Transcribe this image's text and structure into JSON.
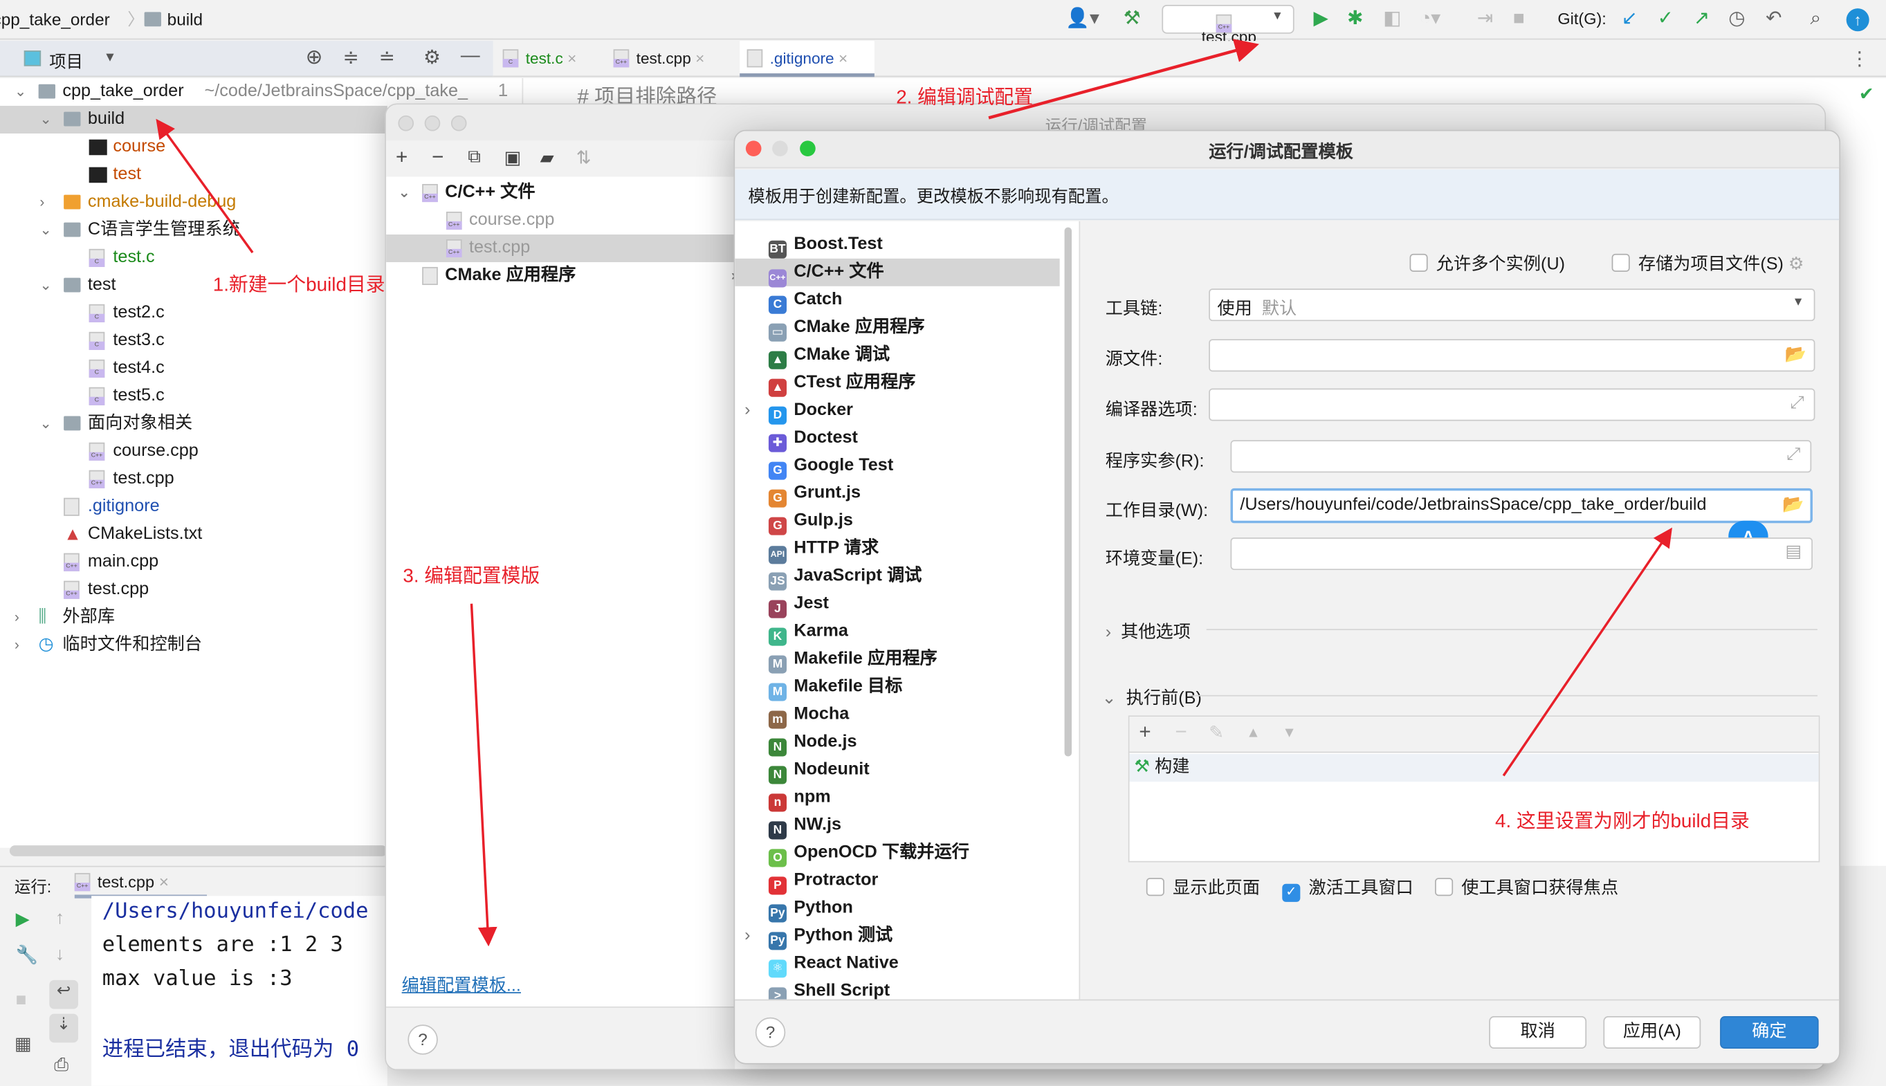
{
  "breadcrumb": {
    "project": "cpp_take_order",
    "folder": "build"
  },
  "toolbar": {
    "run_config": "test.cpp",
    "git_label": "Git(G):"
  },
  "project_panel": {
    "title": "项目"
  },
  "editor_tabs": [
    {
      "label": "test.c",
      "color": "#1a8a1a"
    },
    {
      "label": "test.cpp",
      "color": "#1a1a1a"
    },
    {
      "label": ".gitignore",
      "color": "#1f4fb0",
      "active": true
    }
  ],
  "editor": {
    "line_number": "1",
    "line_text": "# 项目排除路径"
  },
  "tree": [
    {
      "label": "cpp_take_order",
      "path": "~/code/JetbrainsSpace/cpp_take_",
      "level": 0,
      "type": "module",
      "expanded": true
    },
    {
      "label": "build",
      "level": 1,
      "type": "folder",
      "expanded": true,
      "selected": true
    },
    {
      "label": "course",
      "level": 2,
      "type": "exec",
      "color": "#c44a00"
    },
    {
      "label": "test",
      "level": 2,
      "type": "exec",
      "color": "#c44a00"
    },
    {
      "label": "cmake-build-debug",
      "level": 1,
      "type": "folder-orange",
      "collapsed": true,
      "color": "#c47a00"
    },
    {
      "label": "C语言学生管理系统",
      "level": 1,
      "type": "folder",
      "expanded": true
    },
    {
      "label": "test.c",
      "level": 2,
      "type": "c",
      "color": "#1a8a1a"
    },
    {
      "label": "test",
      "level": 1,
      "type": "folder",
      "expanded": true
    },
    {
      "label": "test2.c",
      "level": 2,
      "type": "c"
    },
    {
      "label": "test3.c",
      "level": 2,
      "type": "c"
    },
    {
      "label": "test4.c",
      "level": 2,
      "type": "c"
    },
    {
      "label": "test5.c",
      "level": 2,
      "type": "c"
    },
    {
      "label": "面向对象相关",
      "level": 1,
      "type": "folder",
      "expanded": true
    },
    {
      "label": "course.cpp",
      "level": 2,
      "type": "cpp"
    },
    {
      "label": "test.cpp",
      "level": 2,
      "type": "cpp"
    },
    {
      "label": ".gitignore",
      "level": 1,
      "type": "ignore",
      "color": "#1f4fb0"
    },
    {
      "label": "CMakeLists.txt",
      "level": 1,
      "type": "cmake"
    },
    {
      "label": "main.cpp",
      "level": 1,
      "type": "cpp"
    },
    {
      "label": "test.cpp",
      "level": 1,
      "type": "cpp"
    },
    {
      "label": "外部库",
      "level": 0,
      "type": "lib",
      "collapsed": true
    },
    {
      "label": "临时文件和控制台",
      "level": 0,
      "type": "scratch",
      "collapsed": true
    }
  ],
  "run_panel": {
    "label": "运行:",
    "tab": "test.cpp",
    "console": [
      "/Users/houyunfei/code",
      "elements are :1 2 3",
      "max value is :3",
      "",
      "进程已结束，退出代码为 0"
    ]
  },
  "run_config_dialog": {
    "title": "运行/调试配置",
    "tree": [
      {
        "label": "C/C++ 文件",
        "level": 0,
        "expanded": true
      },
      {
        "label": "course.cpp",
        "level": 1
      },
      {
        "label": "test.cpp",
        "level": 1,
        "selected": true
      },
      {
        "label": "CMake 应用程序",
        "level": 0,
        "collapsed": true
      }
    ],
    "edit_templates_link": "编辑配置模板..."
  },
  "template_dialog": {
    "title": "运行/调试配置模板",
    "info": "模板用于创建新配置。更改模板不影响现有配置。",
    "templates": [
      {
        "label": "Boost.Test",
        "icon": "BT",
        "color": "#555555"
      },
      {
        "label": "C/C++ 文件",
        "icon": "C++",
        "color": "#9b87d6",
        "selected": true
      },
      {
        "label": "Catch",
        "icon": "C",
        "color": "#3a7bd5"
      },
      {
        "label": "CMake 应用程序",
        "icon": "▭",
        "color": "#8aa0b4"
      },
      {
        "label": "CMake 调试",
        "icon": "▲",
        "color": "#2d7d46"
      },
      {
        "label": "CTest 应用程序",
        "icon": "▲",
        "color": "#d04040"
      },
      {
        "label": "Docker",
        "icon": "D",
        "color": "#2496ed",
        "expandable": true
      },
      {
        "label": "Doctest",
        "icon": "✚",
        "color": "#6b5bd8"
      },
      {
        "label": "Google Test",
        "icon": "G",
        "color": "#4285f4"
      },
      {
        "label": "Grunt.js",
        "icon": "G",
        "color": "#e48632"
      },
      {
        "label": "Gulp.js",
        "icon": "G",
        "color": "#cf4647"
      },
      {
        "label": "HTTP 请求",
        "icon": "API",
        "color": "#5c7c9c"
      },
      {
        "label": "JavaScript 调试",
        "icon": "JS",
        "color": "#8aa0b4"
      },
      {
        "label": "Jest",
        "icon": "J",
        "color": "#99425b"
      },
      {
        "label": "Karma",
        "icon": "K",
        "color": "#3fb68b"
      },
      {
        "label": "Makefile 应用程序",
        "icon": "M",
        "color": "#8aa0b4"
      },
      {
        "label": "Makefile 目标",
        "icon": "M",
        "color": "#6fb3e6"
      },
      {
        "label": "Mocha",
        "icon": "m",
        "color": "#8d6748"
      },
      {
        "label": "Node.js",
        "icon": "N",
        "color": "#3c873a"
      },
      {
        "label": "Nodeunit",
        "icon": "N",
        "color": "#3c873a"
      },
      {
        "label": "npm",
        "icon": "n",
        "color": "#cb3837"
      },
      {
        "label": "NW.js",
        "icon": "N",
        "color": "#2e3a48"
      },
      {
        "label": "OpenOCD 下载并运行",
        "icon": "O",
        "color": "#6cbf4a"
      },
      {
        "label": "Protractor",
        "icon": "P",
        "color": "#e23237"
      },
      {
        "label": "Python",
        "icon": "Py",
        "color": "#3776ab"
      },
      {
        "label": "Python 测试",
        "icon": "Py",
        "color": "#3776ab",
        "expandable": true
      },
      {
        "label": "React Native",
        "icon": "⚛",
        "color": "#61dafb"
      },
      {
        "label": "Shell Script",
        "icon": ">",
        "color": "#8aa0b4"
      }
    ],
    "allow_multiple": {
      "label": "允许多个实例(U)",
      "checked": false
    },
    "store_as_file": {
      "label": "存储为项目文件(S)",
      "checked": false
    },
    "toolchain": {
      "label": "工具链:",
      "value": "使用",
      "hint": "默认"
    },
    "source_file": {
      "label": "源文件:",
      "value": ""
    },
    "compiler_options": {
      "label": "编译器选项:",
      "value": ""
    },
    "program_args": {
      "label": "程序实参(R):",
      "value": ""
    },
    "working_dir": {
      "label": "工作目录(W):",
      "value": "/Users/houyunfei/code/JetbrainsSpace/cpp_take_order/build"
    },
    "env_vars": {
      "label": "环境变量(E):",
      "value": ""
    },
    "other_options": "其他选项",
    "before_launch": {
      "label": "执行前(B)",
      "items": [
        "构建"
      ]
    },
    "show_page": {
      "label": "显示此页面",
      "checked": false
    },
    "activate_tool": {
      "label": "激活工具窗口",
      "checked": true
    },
    "focus_tool": {
      "label": "使工具窗口获得焦点",
      "checked": false
    },
    "buttons": {
      "cancel": "取消",
      "apply": "应用(A)",
      "ok": "确定"
    },
    "badge": "A"
  },
  "annotations": [
    "1.新建一个build目录",
    "2. 编辑调试配置",
    "3. 编辑配置模版",
    "4. 这里设置为刚才的build目录"
  ],
  "colors": {
    "accent": "#2f8ee5",
    "annotation": "#e8202a",
    "ok_button": "#2f86d6"
  }
}
